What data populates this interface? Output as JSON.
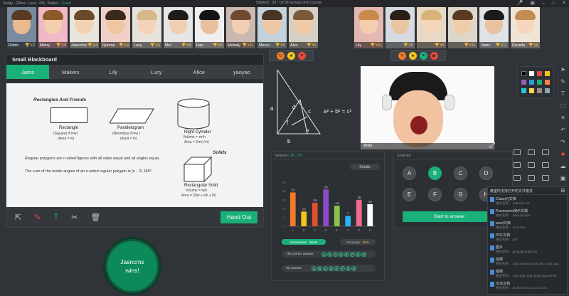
{
  "status_bar": {
    "delay": "Delay : 28ms",
    "loss": "Loss : 0%",
    "status_label": "Status :",
    "status_value": "Good",
    "center": "Started : 03 : 02:30    Group   one   course",
    "icons": [
      "mic-icon",
      "camera-icon",
      "minimize-icon",
      "maximize-icon",
      "close-icon"
    ]
  },
  "students_left": [
    {
      "name": "Robin",
      "count": "X3",
      "bg": "#7a8aa0",
      "hair": "#5a3a22",
      "skin": "#e9b98f"
    },
    {
      "name": "Marry",
      "count": "X9",
      "bg": "#f1b8c6",
      "hair": "#8a5a2b",
      "skin": "#f4cfae"
    },
    {
      "name": "Jasncms",
      "count": "X4",
      "bg": "#e9e4dc",
      "hair": "#6b4a2a",
      "skin": "#f3d2b4"
    },
    {
      "name": "Ilyeene",
      "count": "X4",
      "bg": "#f0d0c6",
      "hair": "#3a2a1c",
      "skin": "#f0c6a2"
    },
    {
      "name": "Lucy",
      "count": "X4",
      "bg": "#e7e2da",
      "hair": "#d7b88a",
      "skin": "#f4d3b8"
    },
    {
      "name": "Mei",
      "count": "X5",
      "bg": "#e6e6e6",
      "hair": "#1d1a18",
      "skin": "#f0cfb0"
    },
    {
      "name": "Hao",
      "count": "X6",
      "bg": "#efefef",
      "hair": "#141414",
      "skin": "#e8c09c"
    },
    {
      "name": "Melody",
      "count": "X11",
      "bg": "#c9b9b0",
      "hair": "#6e4a30",
      "skin": "#f2cdb1"
    },
    {
      "name": "Marco",
      "count": "X5",
      "bg": "#c5d2da",
      "hair": "#4a3322",
      "skin": "#edc7a5"
    },
    {
      "name": "Alex",
      "count": "X5",
      "bg": "#d6d0c4",
      "hair": "#7a5a3a",
      "skin": "#efc9a6"
    }
  ],
  "students_right": [
    {
      "name": "Lily",
      "count": "X11",
      "bg": "#e4b8b2",
      "hair": "#c88a4a",
      "skin": "#f3cdb0"
    },
    {
      "name": "",
      "count": "X8",
      "bg": "#d6dbe2",
      "hair": "#2a2018",
      "skin": "#e9c4a0"
    },
    {
      "name": "",
      "count": "X5",
      "bg": "#e8d8c6",
      "hair": "#d8b27a",
      "skin": "#f4d6bb"
    },
    {
      "name": "",
      "count": "X11",
      "bg": "#ddd6cb",
      "hair": "#5a3a22",
      "skin": "#f0cba9"
    },
    {
      "name": "Jams",
      "count": "X11",
      "bg": "#e0e3e6",
      "hair": "#1a1a1a",
      "skin": "#e8c2a0"
    },
    {
      "name": "Fiorella",
      "count": "X8",
      "bg": "#efe4d6",
      "hair": "#c28c52",
      "skin": "#f5d7bd"
    }
  ],
  "blackboard": {
    "title": "Small Blackboard",
    "tabs": [
      "Jams",
      "Makers",
      "Lily",
      "Lucy",
      "Alice",
      "yaoyao"
    ],
    "active_tab": "Jams",
    "sheet": {
      "heading": "Rectangles And Friends",
      "rectangle": "Rectangle",
      "rectangle_sub": "(Square) if l=w)",
      "rectangle_area": "(Area = w)",
      "parallelogram": "Parallelogram",
      "parallelogram_sub": "(Rhombus if l=w )",
      "parallelogram_area": "(Area = lh)",
      "cylinder": "Right Cylinder",
      "cylinder_vol": "Volume = πr²h",
      "cylinder_area": "Area = 2πr(r+h)",
      "solids": "Solids",
      "solid_name": "Rectangular Solid",
      "solid_vol": "Volume = lwh",
      "solid_area": "Area = 2(lw + wh + lh)",
      "line1": "Regular polygons are n-sided figures with all sides equal and all angles equal.",
      "line2": "The sum of the inside angles of an n-sided regular polygon is (n - 2)·180°."
    },
    "tools": [
      "select-tool-icon",
      "pen-tool-icon",
      "text-tool-icon",
      "scissors-icon",
      "trash-icon"
    ],
    "hand_out": "Hand Out"
  },
  "winner": {
    "name": "Jasncms",
    "suffix": "wins!"
  },
  "whiteboard": {
    "labels": [
      "a",
      "b",
      "c",
      "d",
      "e",
      "f"
    ],
    "formula": "a² + b² = c²"
  },
  "main_video": {
    "name": "Anita"
  },
  "selector_results": {
    "title": "Selector",
    "info": "36 / 36 ·",
    "details": "Details",
    "submission_label": "Submission",
    "submission_value": "36/38",
    "accuracy_label": "Accuracy:",
    "accuracy_value": "60%",
    "correct_label": "The correct answer:",
    "my_label": "My answer:",
    "choices": [
      "A",
      "B",
      "C",
      "D",
      "E",
      "F",
      "G",
      "H"
    ]
  },
  "chart_data": {
    "type": "bar",
    "categories": [
      "A",
      "B",
      "C",
      "D",
      "E",
      "F",
      "G",
      "H"
    ],
    "values": [
      23,
      10,
      16,
      25,
      14,
      7,
      18,
      15
    ],
    "colors": [
      "#f07a2a",
      "#f5c518",
      "#e0502a",
      "#8a4cc8",
      "#8bc34a",
      "#29b6f6",
      "#f06a8a",
      "#ffffff"
    ],
    "ylim": [
      0,
      30
    ],
    "yticks": [
      0,
      2,
      4,
      6,
      8,
      10,
      12,
      14,
      16,
      18,
      20,
      22,
      24,
      26,
      28,
      30
    ]
  },
  "selector_quiz": {
    "title": "Selector",
    "options": [
      "A",
      "B",
      "C",
      "D",
      "E",
      "F",
      "G",
      "H"
    ],
    "selected": "B",
    "start": "Start to answer"
  },
  "palette": {
    "colors": [
      "#000000",
      "#ffffff",
      "#e64a3c",
      "#f5c518",
      "#9b59b6",
      "#3498db",
      "#1ab07a",
      "#ff7f50",
      "#26c6da",
      "#ffd54f",
      "#a1887f",
      "#90a4ae"
    ]
  },
  "files": {
    "header": "教室所支持打开的文件格式",
    "items": [
      {
        "name": "Class(#)文档",
        "sub": "格式名称：.edb.edu.ext"
      },
      {
        "name": "Powerpoint演示文稿",
        "sub": "格式名称：.pptx.ppt.pps"
      },
      {
        "name": "word文档",
        "sub": "格式名称：.docx.doc"
      },
      {
        "name": "PDF文档",
        "sub": "格式名称：.pdf"
      },
      {
        "name": "图片",
        "sub": "格式名称：.jpeg.jpg.png.bmp"
      },
      {
        "name": "音频",
        "sub": "格式名称：.mp3.wav.wma.aac.flac.m4a.ogg"
      },
      {
        "name": "视频",
        "sub": "格式名称：.mp4.3gp.mpg.mpeg.3g2.avi.flv"
      },
      {
        "name": "文本文档",
        "sub": "格式名称：.txt.html.htm.csv.js.ts.css"
      }
    ]
  }
}
